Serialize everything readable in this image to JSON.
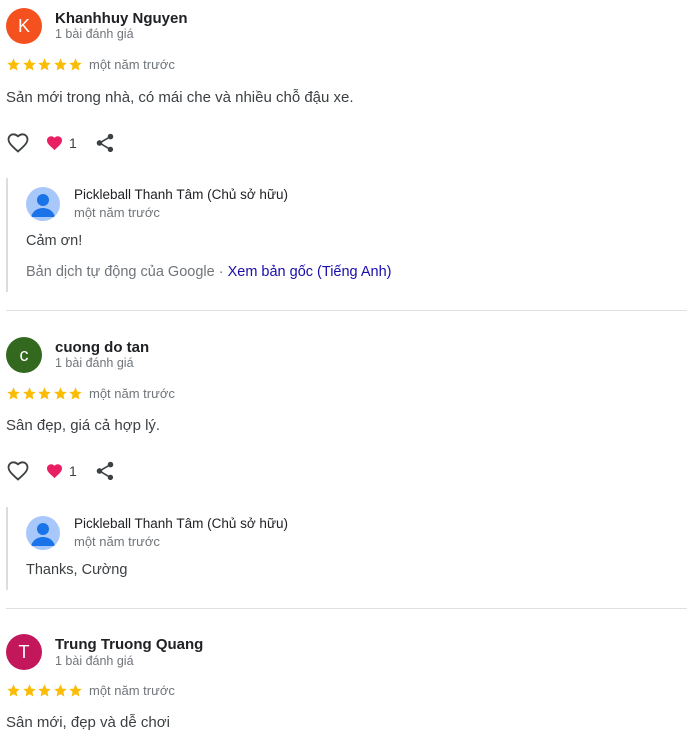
{
  "reviews": [
    {
      "initial": "K",
      "avatar_color": "#f4511e",
      "name": "Khanhhuy Nguyen",
      "review_count": "1 bài đánh giá",
      "rating": 5,
      "date": "một năm trước",
      "text": "Sản mới trong nhà, có mái che và nhiều chỗ đậu xe.",
      "likes": "1",
      "owner": {
        "name": "Pickleball Thanh Tâm (Chủ sở hữu)",
        "date": "một năm trước",
        "text": "Cảm ơn!",
        "translation_note": "Bản dịch tự động của Google",
        "separator": "·",
        "translation_link": "Xem bản gốc (Tiếng Anh)"
      }
    },
    {
      "initial": "c",
      "avatar_color": "#33691e",
      "name": "cuong do tan",
      "review_count": "1 bài đánh giá",
      "rating": 5,
      "date": "một năm trước",
      "text": "Sân đẹp, giá cả hợp lý.",
      "likes": "1",
      "owner": {
        "name": "Pickleball Thanh Tâm (Chủ sở hữu)",
        "date": "một năm trước",
        "text": "Thanks, Cường"
      }
    },
    {
      "initial": "T",
      "avatar_color": "#c2185b",
      "name": "Trung Truong Quang",
      "review_count": "1 bài đánh giá",
      "rating": 5,
      "date": "một năm trước",
      "text": "Sân mới, đẹp và dễ chơi"
    }
  ],
  "colors": {
    "star": "#fbbc04",
    "heart_reaction": "#e91e63",
    "link": "#1a0dab"
  },
  "icons": {
    "like": "heart-outline-icon",
    "reaction": "heart-filled-icon",
    "share": "share-icon",
    "owner_avatar": "person-icon",
    "rating": "star-icon"
  }
}
